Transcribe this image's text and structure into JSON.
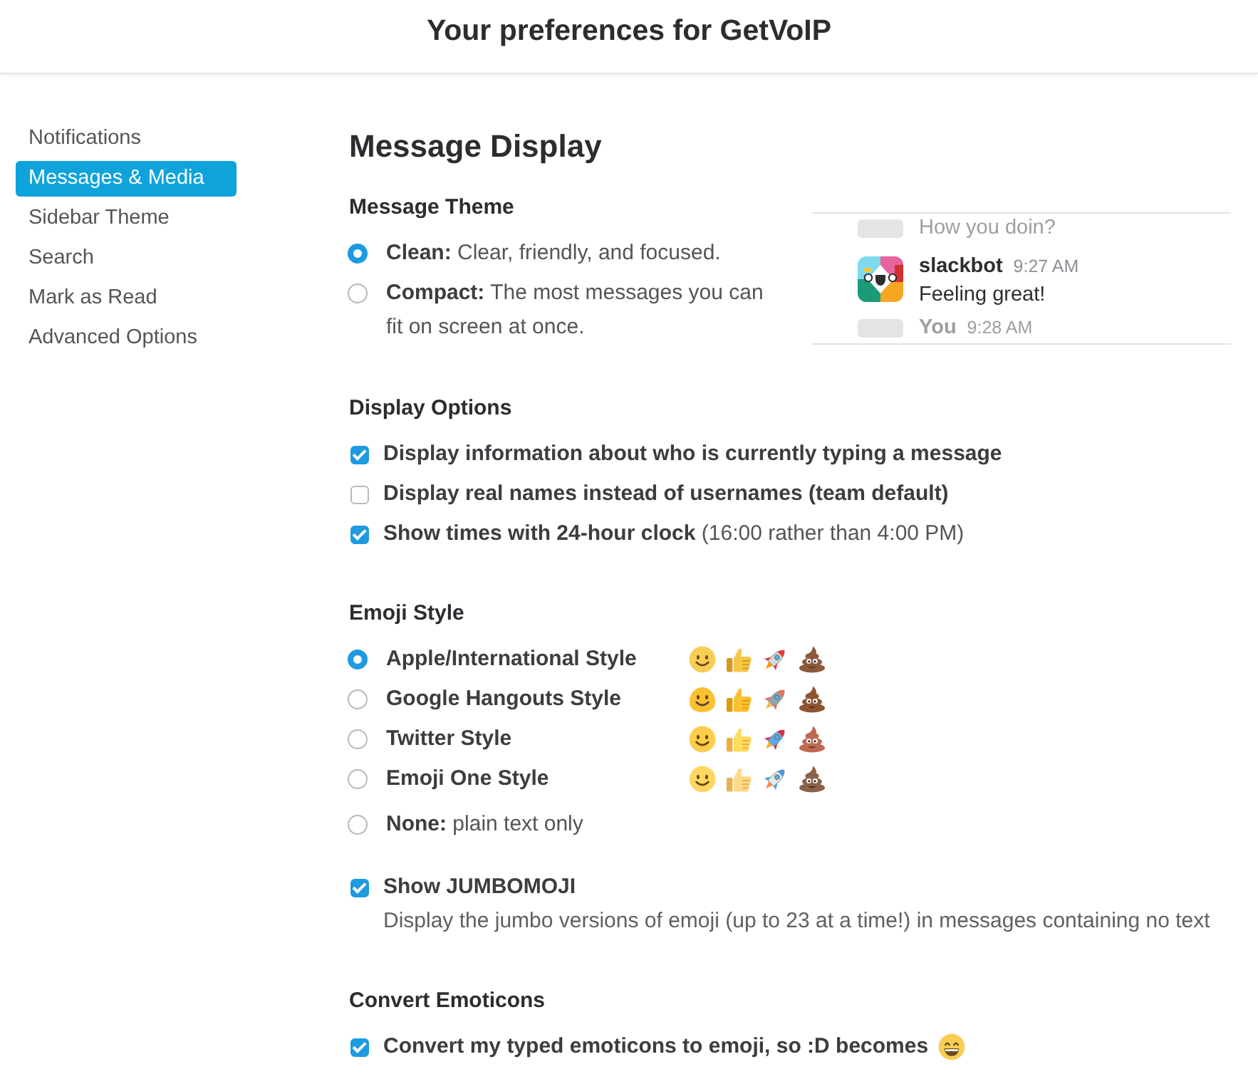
{
  "header": {
    "title": "Your preferences for GetVoIP"
  },
  "sidebar": {
    "items": [
      {
        "label": "Notifications",
        "selected": false
      },
      {
        "label": "Messages & Media",
        "selected": true
      },
      {
        "label": "Sidebar Theme",
        "selected": false
      },
      {
        "label": "Search",
        "selected": false
      },
      {
        "label": "Mark as Read",
        "selected": false
      },
      {
        "label": "Advanced Options",
        "selected": false
      }
    ]
  },
  "page": {
    "title": "Message Display"
  },
  "message_theme": {
    "title": "Message Theme",
    "options": [
      {
        "text": "**Clean:** Clear, friendly, and focused.",
        "selected": true
      },
      {
        "text": "**Compact:** The most messages you can fit on screen at once.",
        "selected": false
      }
    ],
    "preview": {
      "messages": [
        {
          "kind": "faded",
          "text": "How you doin?"
        },
        {
          "kind": "message",
          "author": "slackbot",
          "time": "9:27 AM",
          "text": "Feeling great!"
        },
        {
          "kind": "faded",
          "author": "You",
          "time": "9:28 AM"
        }
      ]
    }
  },
  "display_options": {
    "title": "Display Options",
    "options": [
      {
        "label": "Display information about who is currently typing a message",
        "checked": true
      },
      {
        "label": "Display real names instead of usernames (team default)",
        "checked": false
      },
      {
        "label": "Show times with 24-hour clock",
        "description": "(16:00 rather than 4:00 PM)",
        "checked": true
      }
    ]
  },
  "emoji_style": {
    "title": "Emoji Style",
    "options": [
      {
        "kind": "apple",
        "label": "Apple/International Style",
        "selected": true
      },
      {
        "kind": "google",
        "label": "Google Hangouts Style",
        "selected": false
      },
      {
        "kind": "twitter",
        "label": "Twitter Style",
        "selected": false
      },
      {
        "kind": "emojione",
        "label": "Emoji One Style",
        "selected": false
      },
      {
        "kind": "none",
        "label": "None:",
        "description": "plain text only",
        "selected": false
      }
    ],
    "jumbomoji": {
      "label": "Show JUMBOMOJI",
      "description": "Display the jumbo versions of emoji (up to 23 at a time!) in messages containing no text",
      "checked": true
    }
  },
  "convert_emoticons": {
    "title": "Convert Emoticons",
    "option": {
      "label": "Convert my typed emoticons to emoji, so :D becomes",
      "checked": true
    }
  }
}
